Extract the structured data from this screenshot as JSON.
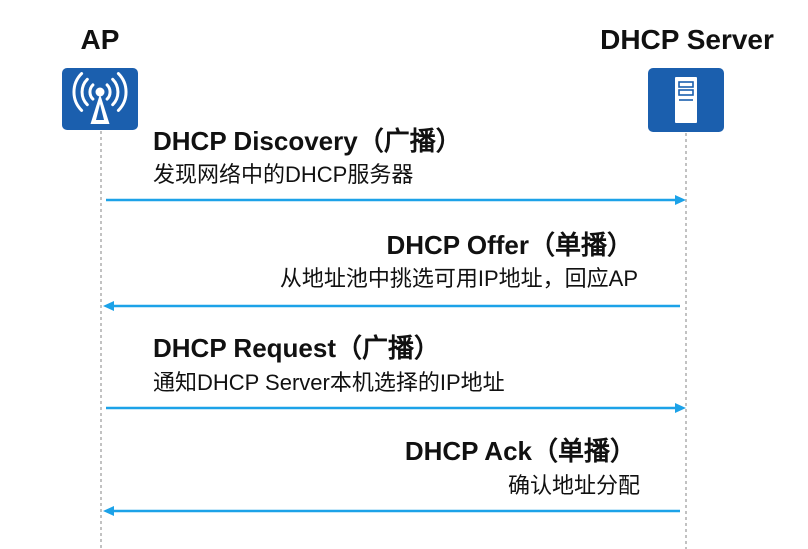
{
  "participants": {
    "ap": {
      "label": "AP",
      "icon": "wireless-ap-icon"
    },
    "server": {
      "label": "DHCP Server",
      "icon": "server-icon"
    }
  },
  "messages": [
    {
      "title": "DHCP Discovery（广播）",
      "description": "发现网络中的DHCP服务器",
      "to_server": true
    },
    {
      "title": "DHCP Offer（单播）",
      "description": "从地址池中挑选可用IP地址，回应AP",
      "to_server": false
    },
    {
      "title": "DHCP Request（广播）",
      "description": "通知DHCP Server本机选择的IP地址",
      "to_server": true
    },
    {
      "title": "DHCP Ack（单播）",
      "description": "确认地址分配",
      "to_server": false
    }
  ],
  "colors": {
    "icon_bg": "#1b5fae",
    "arrow": "#1ca2e8",
    "lifeline": "#b3b3b3",
    "text": "#111111"
  }
}
